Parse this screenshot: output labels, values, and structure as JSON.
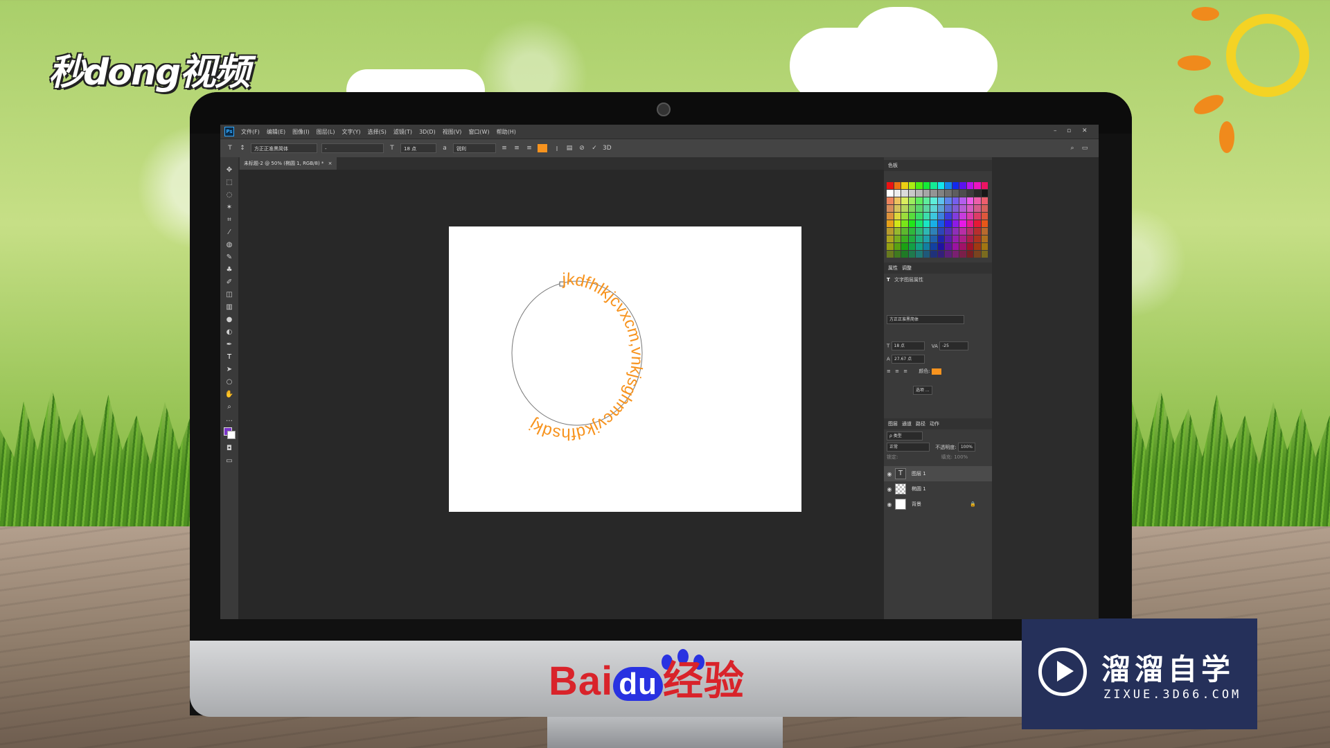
{
  "branding": {
    "miaodong": "秒dong视频",
    "baidu_bai": "Bai",
    "baidu_du": "du",
    "baidu_jingyan": "经验",
    "zixue_cn": "溜溜自学",
    "zixue_en": "ZIXUE.3D66.COM"
  },
  "photoshop": {
    "logo": "Ps",
    "menu": [
      "文件(F)",
      "编辑(E)",
      "图像(I)",
      "图层(L)",
      "文字(Y)",
      "选择(S)",
      "滤镜(T)",
      "3D(D)",
      "视图(V)",
      "窗口(W)",
      "帮助(H)"
    ],
    "window_controls": {
      "minimize": "–",
      "restore": "▫",
      "close": "✕"
    },
    "options": {
      "font_family": "方正正准黑简体",
      "font_style": "-",
      "font_size": "18 点",
      "antialias": "锐利",
      "text_color": "#f7931e"
    },
    "document_tab": "未标题-2 @ 50% (椭圆 1, RGB/8) *",
    "canvas": {
      "path_text": "jkdfhlkjcvxcm,vnkjsghmcvjkdfhsdkj",
      "text_color": "#f7931e"
    },
    "swatches_tab": "色板",
    "properties": {
      "tabs": [
        "属性",
        "调整"
      ],
      "title": "文字图层属性",
      "font": "方正正准黑简体",
      "size": "18 点",
      "tracking": "-25",
      "leading": "27.67 点",
      "color_label": "颜色:",
      "more_button": "选项 ..."
    },
    "layers": {
      "tabs": [
        "图层",
        "通道",
        "路径",
        "动作"
      ],
      "search": "ρ 类型",
      "blend_mode": "正常",
      "opacity_label": "不透明度:",
      "opacity": "100%",
      "lock_label": "锁定:",
      "fill_label": "填充:",
      "fill": "100%",
      "items": [
        {
          "name": "图层 1",
          "kind": "text",
          "selected": true
        },
        {
          "name": "椭圆 1",
          "kind": "shape",
          "selected": false
        },
        {
          "name": "背景",
          "kind": "background",
          "selected": false
        }
      ]
    }
  }
}
